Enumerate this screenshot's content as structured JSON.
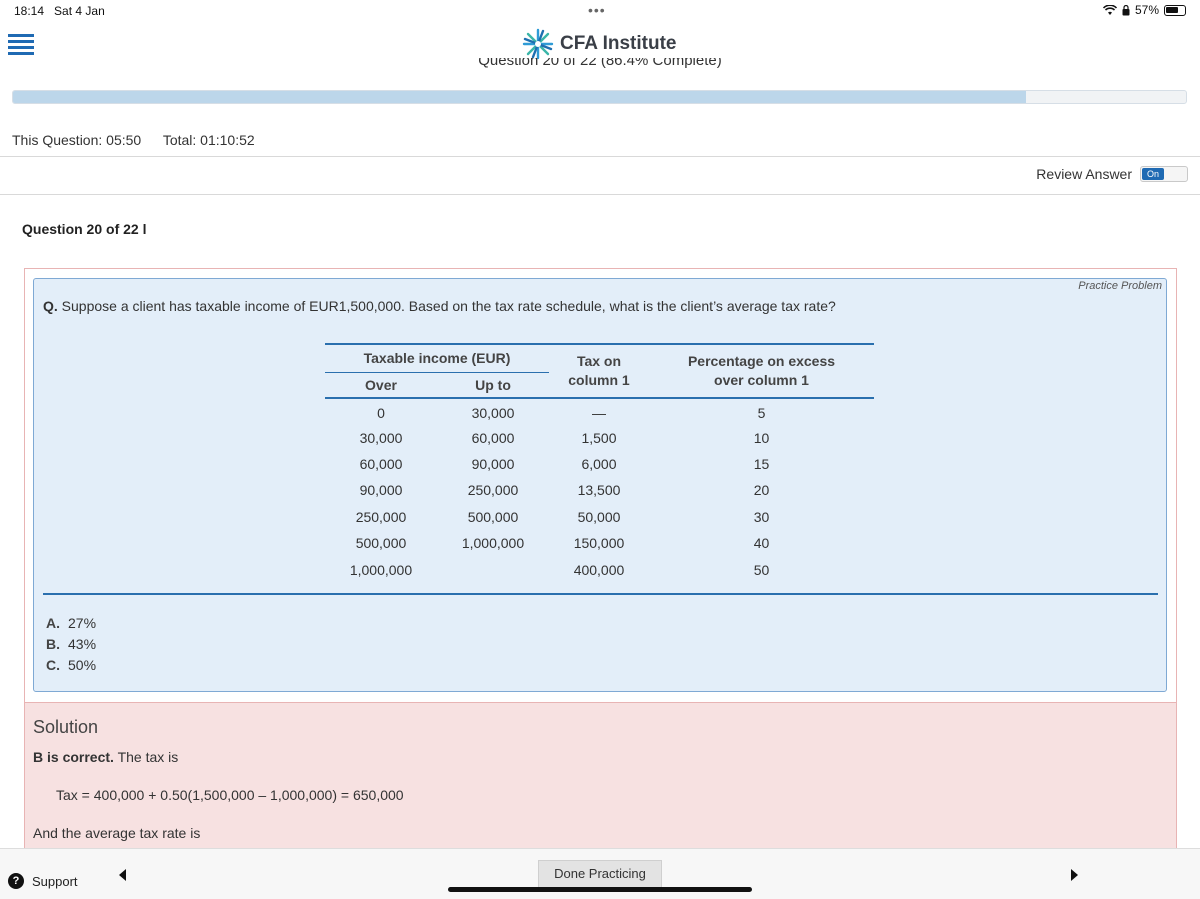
{
  "status_bar": {
    "time": "18:14",
    "date": "Sat 4 Jan",
    "dots": "•••",
    "battery": "57%"
  },
  "header": {
    "logo_text": "CFA Institute",
    "question_counter": "Question 20 of 22 (86.4% Complete)",
    "progress_percent": 86.4
  },
  "timers": {
    "this_question": "This Question: 05:50",
    "total": "Total: 01:10:52"
  },
  "review": {
    "label": "Review Answer",
    "toggle": "On"
  },
  "question": {
    "title": "Question 20 of 22 l",
    "tag": "Practice Problem",
    "prefix": "Q.",
    "text": "Suppose a client has taxable income of EUR1,500,000. Based on the tax rate schedule, what is the client’s average tax rate?"
  },
  "table": {
    "group_header": "Taxable income (EUR)",
    "col_over": "Over",
    "col_upto": "Up to",
    "col_tax_1": "Tax on",
    "col_tax_2": "column 1",
    "col_pct_1": "Percentage on excess",
    "col_pct_2": "over column 1",
    "rows": [
      [
        "0",
        "30,000",
        "—",
        "5"
      ],
      [
        "30,000",
        "60,000",
        "1,500",
        "10"
      ],
      [
        "60,000",
        "90,000",
        "6,000",
        "15"
      ],
      [
        "90,000",
        "250,000",
        "13,500",
        "20"
      ],
      [
        "250,000",
        "500,000",
        "50,000",
        "30"
      ],
      [
        "500,000",
        "1,000,000",
        "150,000",
        "40"
      ],
      [
        "1,000,000",
        "",
        "400,000",
        "50"
      ]
    ]
  },
  "options": [
    {
      "letter": "A.",
      "text": "27%"
    },
    {
      "letter": "B.",
      "text": "43%"
    },
    {
      "letter": "C.",
      "text": "50%"
    }
  ],
  "solution": {
    "title": "Solution",
    "correct": "B is correct.",
    "line1_rest": " The tax is",
    "equation": "Tax = 400,000 + 0.50(1,500,000 – 1,000,000) = 650,000",
    "line2": "And the average tax rate is"
  },
  "footer": {
    "support": "Support",
    "done_button": "Done Practicing"
  },
  "colors": {
    "accent_blue": "#1f6ab3",
    "problem_bg": "#e3eef9",
    "solution_bg": "#f7e1e1",
    "progress_fill": "#bcd6ea"
  }
}
